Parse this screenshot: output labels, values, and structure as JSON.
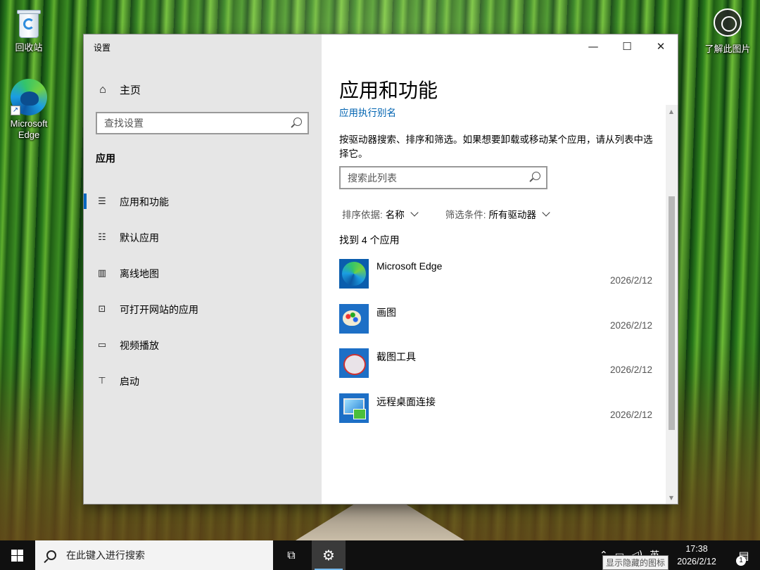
{
  "desktop": {
    "icons": [
      {
        "label": "回收站"
      },
      {
        "label": "Microsoft\nEdge"
      },
      {
        "label": "了解此图片"
      }
    ]
  },
  "window": {
    "title": "设置",
    "controls": {
      "minimize": "—",
      "maximize": "☐",
      "close": "✕"
    }
  },
  "sidebar": {
    "home_label": "主页",
    "search_placeholder": "查找设置",
    "section_title": "应用",
    "items": [
      {
        "label": "应用和功能",
        "icon": "apps-list-icon",
        "active": true
      },
      {
        "label": "默认应用",
        "icon": "default-apps-icon"
      },
      {
        "label": "离线地图",
        "icon": "map-icon"
      },
      {
        "label": "可打开网站的应用",
        "icon": "open-website-icon"
      },
      {
        "label": "视频播放",
        "icon": "video-icon"
      },
      {
        "label": "启动",
        "icon": "startup-icon"
      }
    ]
  },
  "main": {
    "title": "应用和功能",
    "alias_link": "应用执行别名",
    "description": "按驱动器搜索、排序和筛选。如果想要卸载或移动某个应用，请从列表中选择它。",
    "search_placeholder": "搜索此列表",
    "sort_label": "排序依据:",
    "sort_value": "名称",
    "filter_label": "筛选条件:",
    "filter_value": "所有驱动器",
    "found_text": "找到 4 个应用",
    "apps": [
      {
        "name": "Microsoft Edge",
        "date": "2026/2/12"
      },
      {
        "name": "画图",
        "date": "2026/2/12"
      },
      {
        "name": "截图工具",
        "date": "2026/2/12"
      },
      {
        "name": "远程桌面连接",
        "date": "2026/2/12"
      }
    ]
  },
  "taskbar": {
    "search_text": "在此键入进行搜索",
    "tray_ime": "英",
    "time": "17:38",
    "date": "2026/2/12",
    "notification_count": "1",
    "tooltip": "显示隐藏的图标"
  }
}
